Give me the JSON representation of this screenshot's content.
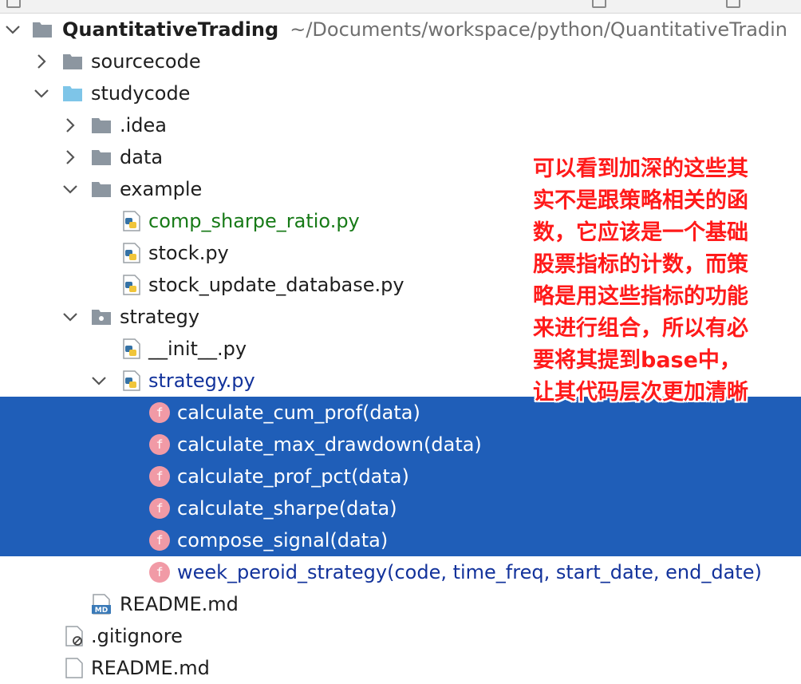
{
  "project": {
    "name": "QuantitativeTrading",
    "path": "~/Documents/workspace/python/QuantitativeTradin"
  },
  "tree": {
    "sourcecode": "sourcecode",
    "studycode": "studycode",
    "idea": ".idea",
    "data": "data",
    "example": "example",
    "comp_sharpe_ratio": "comp_sharpe_ratio.py",
    "stock": "stock.py",
    "stock_update_database": "stock_update_database.py",
    "strategy_folder": "strategy",
    "init": "__init__.py",
    "strategy_file": "strategy.py",
    "functions": [
      "calculate_cum_prof(data)",
      "calculate_max_drawdown(data)",
      "calculate_prof_pct(data)",
      "calculate_sharpe(data)",
      "compose_signal(data)",
      "week_peroid_strategy(code, time_freq, start_date, end_date)"
    ],
    "readme_inner": "README.md",
    "gitignore": ".gitignore",
    "readme_outer": "README.md"
  },
  "icons": {
    "function_letter": "f",
    "md_badge": "MD"
  },
  "annotation": {
    "lines": [
      "可以看到加深的这些其",
      "实不是跟策略相关的函",
      "数，它应该是一个基础",
      "股票指标的计数，而策",
      "略是用这些指标的功能",
      "来进行组合，所以有必",
      "要将其提到base中，",
      "让其代码层次更加清晰"
    ]
  },
  "colors": {
    "selection": "#1f5eb8",
    "annotation": "#ff1a1a",
    "function_icon": "#f19aa6",
    "folder": "#8c96a0",
    "source_folder": "#7ec5e8",
    "modified_file": "#177a17",
    "changed_file": "#12329b"
  }
}
